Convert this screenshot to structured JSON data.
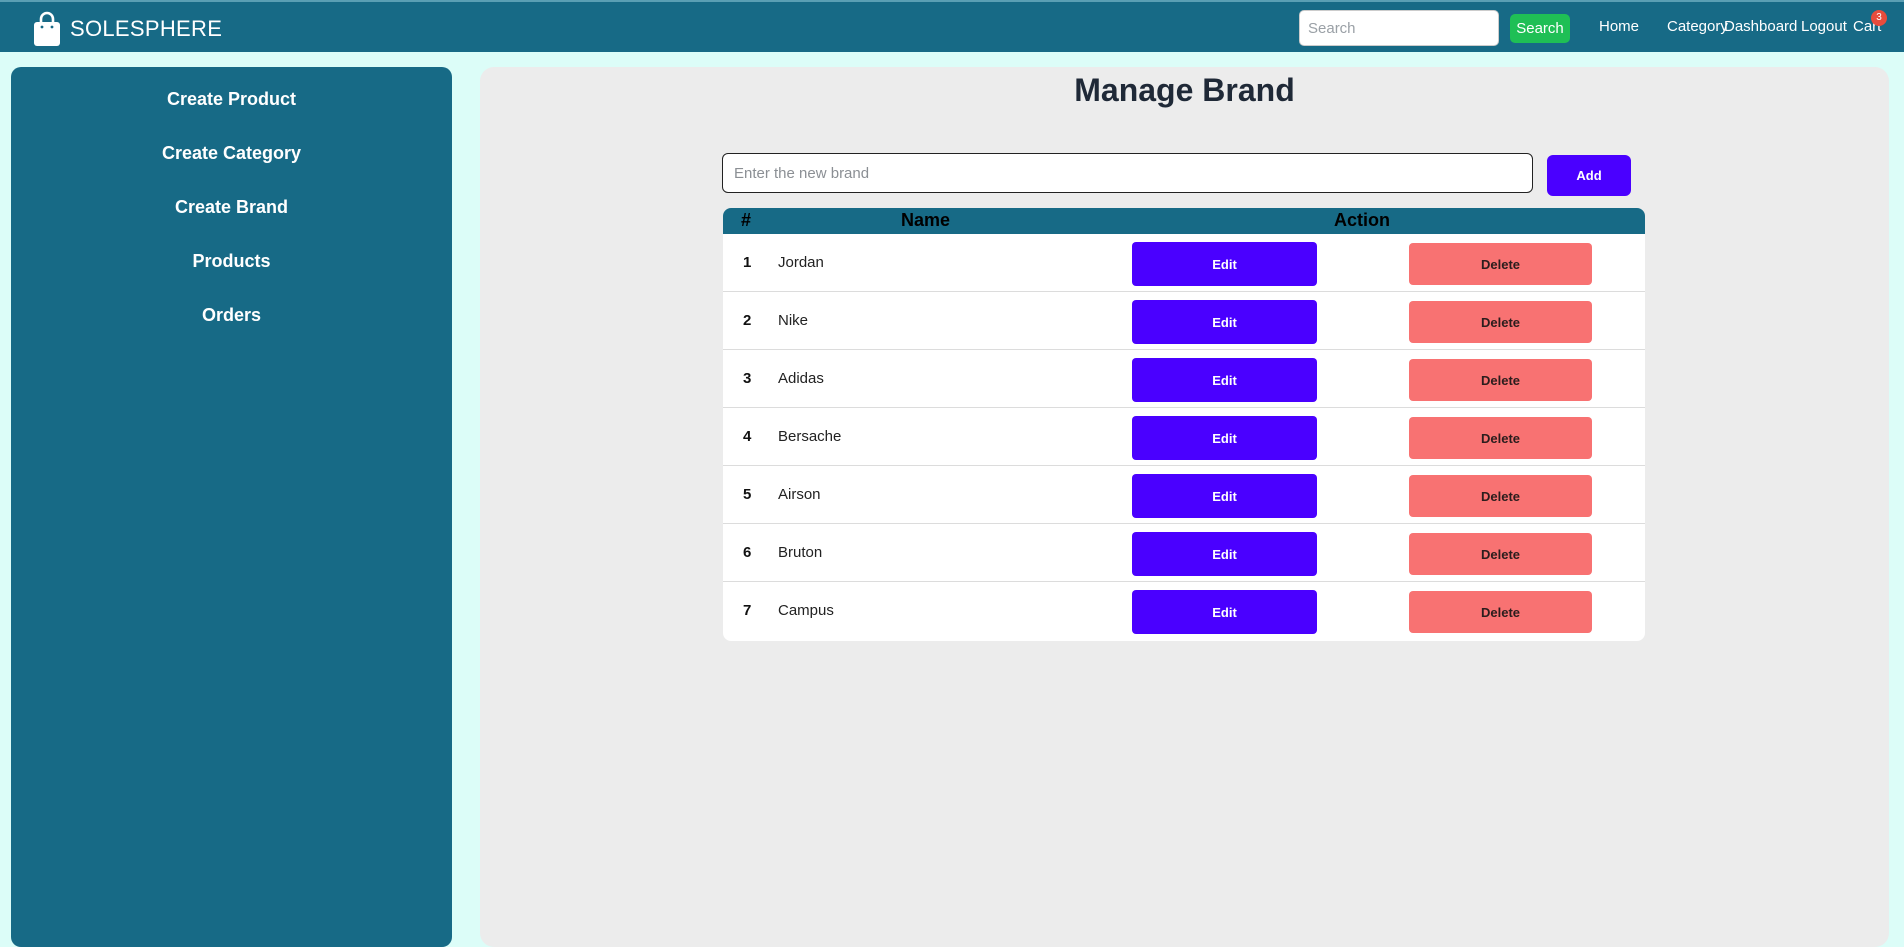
{
  "header": {
    "logo_text": "SOLESPHERE",
    "logo_icon": "shopping-bag-icon",
    "search_placeholder": "Search",
    "search_button": "Search",
    "nav": [
      "Home",
      "Category",
      "Dashboard",
      "Logout",
      "Cart"
    ],
    "cart_count": "3"
  },
  "sidebar": {
    "items": [
      "Create Product",
      "Create Category",
      "Create Brand",
      "Products",
      "Orders"
    ]
  },
  "main": {
    "title": "Manage Brand",
    "brand_input_placeholder": "Enter the new brand",
    "add_button": "Add",
    "table": {
      "headers": [
        "#",
        "Name",
        "Action"
      ],
      "rows": [
        {
          "num": "1",
          "name": "Jordan",
          "edit": "Edit",
          "delete": "Delete"
        },
        {
          "num": "2",
          "name": "Nike",
          "edit": "Edit",
          "delete": "Delete"
        },
        {
          "num": "3",
          "name": "Adidas",
          "edit": "Edit",
          "delete": "Delete"
        },
        {
          "num": "4",
          "name": "Bersache",
          "edit": "Edit",
          "delete": "Delete"
        },
        {
          "num": "5",
          "name": "Airson",
          "edit": "Edit",
          "delete": "Delete"
        },
        {
          "num": "6",
          "name": "Bruton",
          "edit": "Edit",
          "delete": "Delete"
        },
        {
          "num": "7",
          "name": "Campus",
          "edit": "Edit",
          "delete": "Delete"
        }
      ]
    }
  },
  "colors": {
    "header_bg": "#176a86",
    "page_bg": "#dcfdf8",
    "content_bg": "#ececec",
    "primary_button": "#4a00ff",
    "delete_button": "#f87272",
    "search_button": "#1fbf55",
    "badge": "#e74c3c"
  }
}
